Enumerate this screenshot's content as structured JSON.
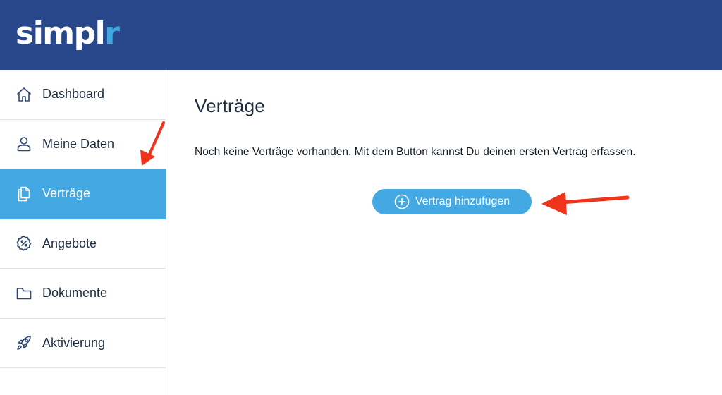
{
  "app": {
    "logo_main": "simpl",
    "logo_accent": "r"
  },
  "sidebar": {
    "items": [
      {
        "label": "Dashboard",
        "icon": "home-icon",
        "active": false
      },
      {
        "label": "Meine Daten",
        "icon": "user-icon",
        "active": false
      },
      {
        "label": "Verträge",
        "icon": "documents-icon",
        "active": true
      },
      {
        "label": "Angebote",
        "icon": "percent-badge-icon",
        "active": false
      },
      {
        "label": "Dokumente",
        "icon": "folder-icon",
        "active": false
      },
      {
        "label": "Aktivierung",
        "icon": "rocket-icon",
        "active": false
      }
    ]
  },
  "main": {
    "title": "Verträge",
    "empty_message": "Noch keine Verträge vorhanden. Mit dem Button kannst Du deinen ersten Vertrag erfassen.",
    "add_button_label": "Vertrag hinzufügen"
  },
  "colors": {
    "header": "#29488c",
    "accent": "#44a8e2",
    "annotation_arrow": "#f0341c"
  }
}
